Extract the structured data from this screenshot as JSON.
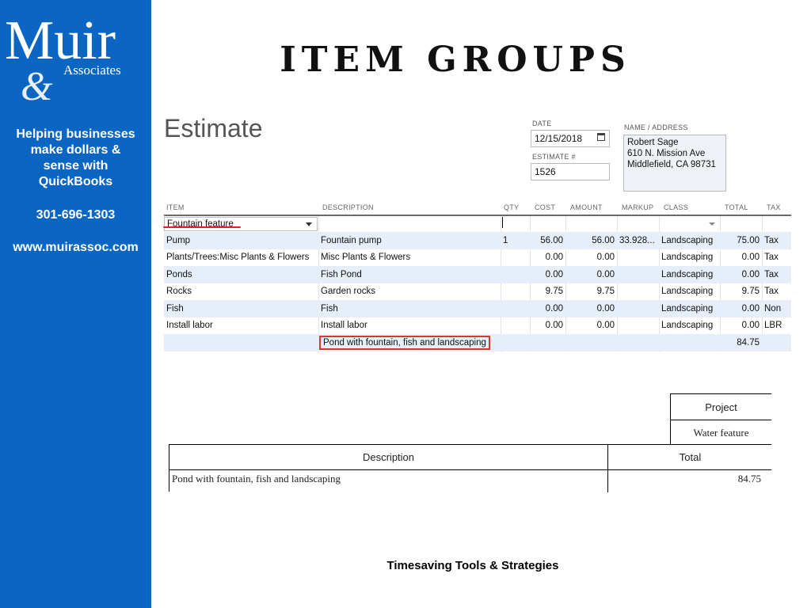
{
  "sidebar": {
    "logo": {
      "brand": "Muir",
      "ampersand": "&",
      "subbrand": "Associates"
    },
    "tagline": [
      "Helping businesses",
      "make dollars &",
      "sense with",
      "QuickBooks"
    ],
    "phone": "301-696-1303",
    "website": "www.muirassoc.com",
    "background_color": "#0a66c2"
  },
  "slide_title": "Item Groups",
  "estimate": {
    "title": "Estimate",
    "date_label": "DATE",
    "date": "12/15/2018",
    "estimate_number_label": "ESTIMATE #",
    "estimate_number": "1526",
    "name_address_label": "NAME / ADDRESS",
    "address_lines": [
      "Robert Sage",
      "610 N. Mission Ave",
      "Middlefield, CA 98731"
    ],
    "calendar_icon": "calendar-icon"
  },
  "items_table": {
    "columns": [
      "ITEM",
      "DESCRIPTION",
      "QTY",
      "COST",
      "AMOUNT",
      "MARKUP",
      "CLASS",
      "TOTAL",
      "TAX"
    ],
    "group_item": "Fountain feature",
    "rows": [
      {
        "item": "Pump",
        "description": "Fountain pump",
        "qty": "1",
        "cost": "56.00",
        "amount": "56.00",
        "markup": "33.928...",
        "class": "Landscaping",
        "total": "75.00",
        "tax": "Tax"
      },
      {
        "item": "Plants/Trees:Misc Plants & Flowers",
        "description": "Misc Plants & Flowers",
        "qty": "",
        "cost": "0.00",
        "amount": "0.00",
        "markup": "",
        "class": "Landscaping",
        "total": "0.00",
        "tax": "Tax"
      },
      {
        "item": "Ponds",
        "description": "Fish Pond",
        "qty": "",
        "cost": "0.00",
        "amount": "0.00",
        "markup": "",
        "class": "Landscaping",
        "total": "0.00",
        "tax": "Tax"
      },
      {
        "item": "Rocks",
        "description": "Garden rocks",
        "qty": "",
        "cost": "9.75",
        "amount": "9.75",
        "markup": "",
        "class": "Landscaping",
        "total": "9.75",
        "tax": "Tax"
      },
      {
        "item": "Fish",
        "description": "Fish",
        "qty": "",
        "cost": "0.00",
        "amount": "0.00",
        "markup": "",
        "class": "Landscaping",
        "total": "0.00",
        "tax": "Non"
      },
      {
        "item": "Install labor",
        "description": "Install labor",
        "qty": "",
        "cost": "0.00",
        "amount": "0.00",
        "markup": "",
        "class": "Landscaping",
        "total": "0.00",
        "tax": "LBR"
      },
      {
        "item": "",
        "description": "Pond with fountain, fish and landscaping",
        "qty": "",
        "cost": "",
        "amount": "",
        "markup": "",
        "class": "",
        "total": "84.75",
        "tax": ""
      }
    ]
  },
  "printed": {
    "project_header": "Project",
    "project_value": "Water feature",
    "description_header": "Description",
    "total_header": "Total",
    "description_value": "Pond with fountain, fish and landscaping",
    "total_value": "84.75"
  },
  "footer": "Timesaving Tools & Strategies",
  "colors": {
    "highlight": "#dd3333",
    "row_shade": "#e6eef9",
    "sidebar": "#0a66c2"
  }
}
